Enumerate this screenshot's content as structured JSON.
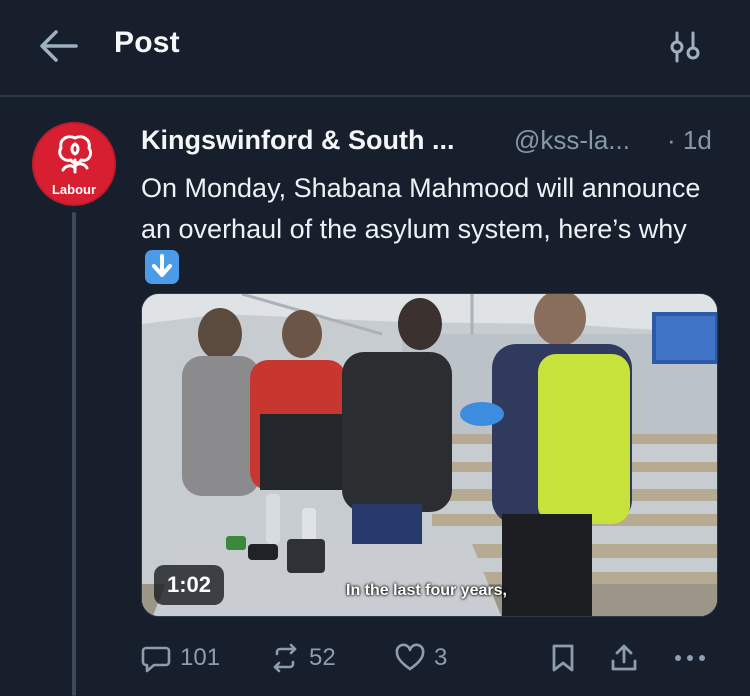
{
  "topbar": {
    "title": "Post",
    "back_icon": "arrow-left-icon",
    "settings_icon": "sliders-icon"
  },
  "post": {
    "author": {
      "name": "Kingswinford & South ...",
      "handle": "@kss-la...",
      "avatar_text": "Labour"
    },
    "time": "· 1d",
    "text": "On Monday, Shabana Mahmood will announce an overhaul of the asylum system, here’s why",
    "emoji": "down-arrow-emoji",
    "media": {
      "duration": "1:02",
      "subtitle": "In the last four years,"
    },
    "stats": {
      "replies": "101",
      "reposts": "52",
      "likes": "3"
    }
  },
  "colors": {
    "background": "#161f2b",
    "text": "#f2f4f7",
    "muted": "#8797aa",
    "labour_red": "#d81f32",
    "emoji_blue": "#4c9be8"
  }
}
